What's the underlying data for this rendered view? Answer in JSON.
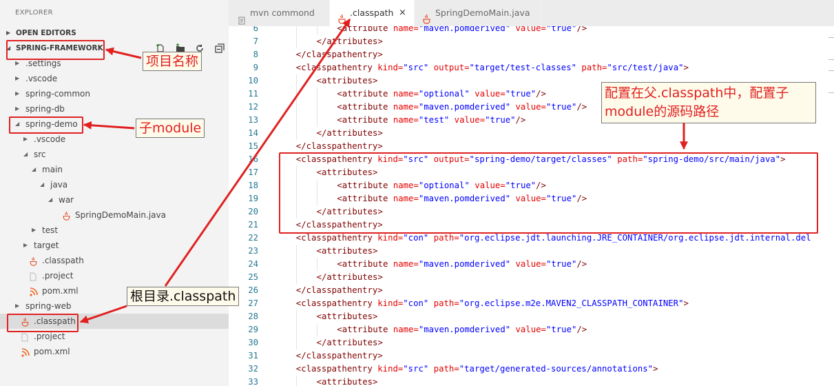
{
  "sidebar": {
    "title": "EXPLORER",
    "open_editors": "OPEN EDITORS",
    "project": "SPRING-FRAMEWORK",
    "actions": [
      "new-file-icon",
      "new-folder-icon",
      "refresh-icon",
      "collapse-all-icon"
    ],
    "tree": [
      {
        "label": ".settings",
        "depth": 1,
        "kind": "folder",
        "open": false
      },
      {
        "label": ".vscode",
        "depth": 1,
        "kind": "folder",
        "open": false
      },
      {
        "label": "spring-common",
        "depth": 1,
        "kind": "folder",
        "open": false
      },
      {
        "label": "spring-db",
        "depth": 1,
        "kind": "folder",
        "open": false
      },
      {
        "label": "spring-demo",
        "depth": 1,
        "kind": "folder",
        "open": true
      },
      {
        "label": ".vscode",
        "depth": 2,
        "kind": "folder",
        "open": false
      },
      {
        "label": "src",
        "depth": 2,
        "kind": "folder",
        "open": true
      },
      {
        "label": "main",
        "depth": 3,
        "kind": "folder",
        "open": true
      },
      {
        "label": "java",
        "depth": 4,
        "kind": "folder",
        "open": true
      },
      {
        "label": "war",
        "depth": 5,
        "kind": "folder",
        "open": true
      },
      {
        "label": "SpringDemoMain.java",
        "depth": 6,
        "kind": "java"
      },
      {
        "label": "test",
        "depth": 3,
        "kind": "folder",
        "open": false
      },
      {
        "label": "target",
        "depth": 2,
        "kind": "folder",
        "open": false
      },
      {
        "label": ".classpath",
        "depth": 2,
        "kind": "java"
      },
      {
        "label": ".project",
        "depth": 2,
        "kind": "file"
      },
      {
        "label": "pom.xml",
        "depth": 2,
        "kind": "xml"
      },
      {
        "label": "spring-web",
        "depth": 1,
        "kind": "folder",
        "open": false
      },
      {
        "label": ".classpath",
        "depth": 1,
        "kind": "java",
        "selected": true
      },
      {
        "label": ".project",
        "depth": 1,
        "kind": "file"
      },
      {
        "label": "pom.xml",
        "depth": 1,
        "kind": "xml"
      }
    ]
  },
  "tabs": [
    {
      "label": "mvn commond",
      "icon": "terminal-icon",
      "active": false
    },
    {
      "label": ".classpath",
      "icon": "java-icon",
      "active": true,
      "close": "×"
    },
    {
      "label": "SpringDemoMain.java",
      "icon": "java-icon",
      "active": false
    }
  ],
  "code_lines": [
    {
      "n": "6",
      "indent": 3,
      "parts": [
        [
          "p",
          "<"
        ],
        [
          "t",
          "attribute"
        ],
        [
          "a",
          " name="
        ],
        [
          "v",
          "\"maven.pomderived\""
        ],
        [
          "a",
          " value="
        ],
        [
          "v",
          "\"true\""
        ],
        [
          "p",
          "/>"
        ]
      ]
    },
    {
      "n": "7",
      "indent": 2,
      "parts": [
        [
          "p",
          "</"
        ],
        [
          "t",
          "attributes"
        ],
        [
          "p",
          ">"
        ]
      ]
    },
    {
      "n": "8",
      "indent": 1,
      "parts": [
        [
          "p",
          "</"
        ],
        [
          "t",
          "classpathentry"
        ],
        [
          "p",
          ">"
        ]
      ]
    },
    {
      "n": "9",
      "indent": 1,
      "parts": [
        [
          "p",
          "<"
        ],
        [
          "t",
          "classpathentry"
        ],
        [
          "a",
          " kind="
        ],
        [
          "v",
          "\"src\""
        ],
        [
          "a",
          " output="
        ],
        [
          "v",
          "\"target/test-classes\""
        ],
        [
          "a",
          " path="
        ],
        [
          "v",
          "\"src/test/java\""
        ],
        [
          "p",
          ">"
        ]
      ]
    },
    {
      "n": "10",
      "indent": 2,
      "parts": [
        [
          "p",
          "<"
        ],
        [
          "t",
          "attributes"
        ],
        [
          "p",
          ">"
        ]
      ]
    },
    {
      "n": "11",
      "indent": 3,
      "parts": [
        [
          "p",
          "<"
        ],
        [
          "t",
          "attribute"
        ],
        [
          "a",
          " name="
        ],
        [
          "v",
          "\"optional\""
        ],
        [
          "a",
          " value="
        ],
        [
          "v",
          "\"true\""
        ],
        [
          "p",
          "/>"
        ]
      ]
    },
    {
      "n": "12",
      "indent": 3,
      "parts": [
        [
          "p",
          "<"
        ],
        [
          "t",
          "attribute"
        ],
        [
          "a",
          " name="
        ],
        [
          "v",
          "\"maven.pomderived\""
        ],
        [
          "a",
          " value="
        ],
        [
          "v",
          "\"true\""
        ],
        [
          "p",
          "/>"
        ]
      ]
    },
    {
      "n": "13",
      "indent": 3,
      "parts": [
        [
          "p",
          "<"
        ],
        [
          "t",
          "attribute"
        ],
        [
          "a",
          " name="
        ],
        [
          "v",
          "\"test\""
        ],
        [
          "a",
          " value="
        ],
        [
          "v",
          "\"true\""
        ],
        [
          "p",
          "/>"
        ]
      ]
    },
    {
      "n": "14",
      "indent": 2,
      "parts": [
        [
          "p",
          "</"
        ],
        [
          "t",
          "attributes"
        ],
        [
          "p",
          ">"
        ]
      ]
    },
    {
      "n": "15",
      "indent": 1,
      "parts": [
        [
          "p",
          "</"
        ],
        [
          "t",
          "classpathentry"
        ],
        [
          "p",
          ">"
        ]
      ]
    },
    {
      "n": "16",
      "indent": 1,
      "parts": [
        [
          "p",
          "<"
        ],
        [
          "t",
          "classpathentry"
        ],
        [
          "a",
          " kind="
        ],
        [
          "v",
          "\"src\""
        ],
        [
          "a",
          " output="
        ],
        [
          "v",
          "\"spring-demo/target/classes\""
        ],
        [
          "a",
          " path="
        ],
        [
          "v",
          "\"spring-demo/src/main/java\""
        ],
        [
          "p",
          ">"
        ]
      ]
    },
    {
      "n": "17",
      "indent": 2,
      "parts": [
        [
          "p",
          "<"
        ],
        [
          "t",
          "attributes"
        ],
        [
          "p",
          ">"
        ]
      ]
    },
    {
      "n": "18",
      "indent": 3,
      "parts": [
        [
          "p",
          "<"
        ],
        [
          "t",
          "attribute"
        ],
        [
          "a",
          " name="
        ],
        [
          "v",
          "\"optional\""
        ],
        [
          "a",
          " value="
        ],
        [
          "v",
          "\"true\""
        ],
        [
          "p",
          "/>"
        ]
      ]
    },
    {
      "n": "19",
      "indent": 3,
      "parts": [
        [
          "p",
          "<"
        ],
        [
          "t",
          "attribute"
        ],
        [
          "a",
          " name="
        ],
        [
          "v",
          "\"maven.pomderived\""
        ],
        [
          "a",
          " value="
        ],
        [
          "v",
          "\"true\""
        ],
        [
          "p",
          "/>"
        ]
      ]
    },
    {
      "n": "20",
      "indent": 2,
      "parts": [
        [
          "p",
          "</"
        ],
        [
          "t",
          "attributes"
        ],
        [
          "p",
          ">"
        ]
      ]
    },
    {
      "n": "21",
      "indent": 1,
      "parts": [
        [
          "p",
          "</"
        ],
        [
          "t",
          "classpathentry"
        ],
        [
          "p",
          ">"
        ]
      ]
    },
    {
      "n": "22",
      "indent": 1,
      "parts": [
        [
          "p",
          "<"
        ],
        [
          "t",
          "classpathentry"
        ],
        [
          "a",
          " kind="
        ],
        [
          "v",
          "\"con\""
        ],
        [
          "a",
          " path="
        ],
        [
          "v",
          "\"org.eclipse.jdt.launching.JRE_CONTAINER/org.eclipse.jdt.internal.del"
        ]
      ]
    },
    {
      "n": "23",
      "indent": 2,
      "parts": [
        [
          "p",
          "<"
        ],
        [
          "t",
          "attributes"
        ],
        [
          "p",
          ">"
        ]
      ]
    },
    {
      "n": "24",
      "indent": 3,
      "parts": [
        [
          "p",
          "<"
        ],
        [
          "t",
          "attribute"
        ],
        [
          "a",
          " name="
        ],
        [
          "v",
          "\"maven.pomderived\""
        ],
        [
          "a",
          " value="
        ],
        [
          "v",
          "\"true\""
        ],
        [
          "p",
          "/>"
        ]
      ]
    },
    {
      "n": "25",
      "indent": 2,
      "parts": [
        [
          "p",
          "</"
        ],
        [
          "t",
          "attributes"
        ],
        [
          "p",
          ">"
        ]
      ]
    },
    {
      "n": "26",
      "indent": 1,
      "parts": [
        [
          "p",
          "</"
        ],
        [
          "t",
          "classpathentry"
        ],
        [
          "p",
          ">"
        ]
      ]
    },
    {
      "n": "27",
      "indent": 1,
      "parts": [
        [
          "p",
          "<"
        ],
        [
          "t",
          "classpathentry"
        ],
        [
          "a",
          " kind="
        ],
        [
          "v",
          "\"con\""
        ],
        [
          "a",
          " path="
        ],
        [
          "v",
          "\"org.eclipse.m2e.MAVEN2_CLASSPATH_CONTAINER\""
        ],
        [
          "p",
          ">"
        ]
      ]
    },
    {
      "n": "28",
      "indent": 2,
      "parts": [
        [
          "p",
          "<"
        ],
        [
          "t",
          "attributes"
        ],
        [
          "p",
          ">"
        ]
      ]
    },
    {
      "n": "29",
      "indent": 3,
      "parts": [
        [
          "p",
          "<"
        ],
        [
          "t",
          "attribute"
        ],
        [
          "a",
          " name="
        ],
        [
          "v",
          "\"maven.pomderived\""
        ],
        [
          "a",
          " value="
        ],
        [
          "v",
          "\"true\""
        ],
        [
          "p",
          "/>"
        ]
      ]
    },
    {
      "n": "30",
      "indent": 2,
      "parts": [
        [
          "p",
          "</"
        ],
        [
          "t",
          "attributes"
        ],
        [
          "p",
          ">"
        ]
      ]
    },
    {
      "n": "31",
      "indent": 1,
      "parts": [
        [
          "p",
          "</"
        ],
        [
          "t",
          "classpathentry"
        ],
        [
          "p",
          ">"
        ]
      ]
    },
    {
      "n": "32",
      "indent": 1,
      "parts": [
        [
          "p",
          "<"
        ],
        [
          "t",
          "classpathentry"
        ],
        [
          "a",
          " kind="
        ],
        [
          "v",
          "\"src\""
        ],
        [
          "a",
          " path="
        ],
        [
          "v",
          "\"target/generated-sources/annotations\""
        ],
        [
          "p",
          ">"
        ]
      ]
    },
    {
      "n": "33",
      "indent": 2,
      "parts": [
        [
          "p",
          "<"
        ],
        [
          "t",
          "attributes"
        ],
        [
          "p",
          ">"
        ]
      ]
    }
  ],
  "annotations": {
    "project_name": "项目名称",
    "sub_module": "子module",
    "root_classpath": "根目录.classpath",
    "config_note_line1": "配置在父.classpath中，配置子",
    "config_note_line2": "module的源码路径"
  },
  "colors": {
    "annotation_red": "#e02020",
    "tag": "#800000",
    "attr": "#e50000",
    "value": "#0000ff",
    "line_number": "#237893",
    "sidebar_bg": "#f3f3f3",
    "tabbar_bg": "#ececec"
  }
}
